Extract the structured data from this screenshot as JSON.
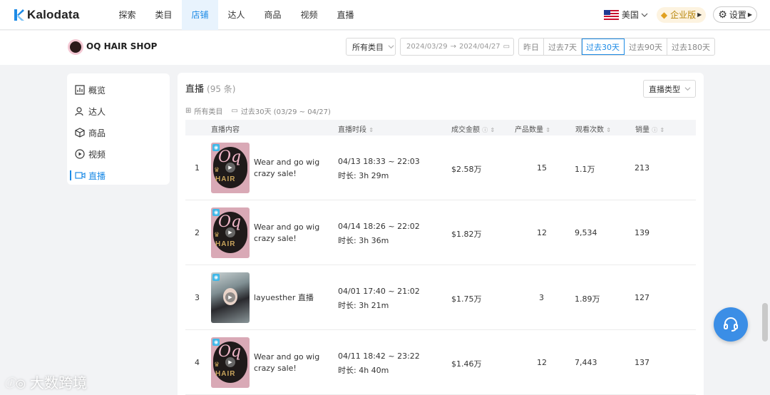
{
  "brand": {
    "name": "Kalodata",
    "color": "#1d8be6"
  },
  "nav": {
    "items": [
      {
        "label": "探索",
        "active": false
      },
      {
        "label": "类目",
        "active": false
      },
      {
        "label": "店铺",
        "active": true
      },
      {
        "label": "达人",
        "active": false
      },
      {
        "label": "商品",
        "active": false
      },
      {
        "label": "视频",
        "active": false
      },
      {
        "label": "直播",
        "active": false
      }
    ],
    "region": "美国",
    "enterprise": "企业版",
    "settings": "设置"
  },
  "shop": {
    "name": "OQ HAIR SHOP",
    "category_select": "所有类目",
    "date_start": "2024/03/29",
    "date_end": "2024/04/27",
    "periods": [
      {
        "label": "昨日",
        "active": false
      },
      {
        "label": "过去7天",
        "active": false
      },
      {
        "label": "过去30天",
        "active": true
      },
      {
        "label": "过去90天",
        "active": false
      },
      {
        "label": "过去180天",
        "active": false
      }
    ]
  },
  "sidebar": {
    "items": [
      {
        "label": "概览",
        "icon": "overview-icon",
        "active": false
      },
      {
        "label": "达人",
        "icon": "creator-icon",
        "active": false
      },
      {
        "label": "商品",
        "icon": "product-box-icon",
        "active": false
      },
      {
        "label": "视频",
        "icon": "video-play-icon",
        "active": false
      },
      {
        "label": "直播",
        "icon": "live-camera-icon",
        "active": true
      }
    ]
  },
  "panel": {
    "title": "直播",
    "count": "(95 条)",
    "type_select": "直播类型",
    "filter_category": "所有类目",
    "filter_period": "过去30天 (03/29 ~ 04/27)"
  },
  "table": {
    "headers": {
      "content": "直播内容",
      "time": "直播时段",
      "revenue": "成交金额",
      "products": "产品数量",
      "views": "观看次数",
      "sales": "销量"
    },
    "rows": [
      {
        "rank": "1",
        "thumb": "logo",
        "title": "Wear and go wig crazy sale!",
        "time": "04/13 18:33 ~ 22:03",
        "duration": "时长: 3h 29m",
        "revenue": "$2.58万",
        "products": "15",
        "views": "1.1万",
        "sales": "213"
      },
      {
        "rank": "2",
        "thumb": "logo",
        "title": "Wear and go wig crazy sale!",
        "time": "04/14 18:26 ~ 22:02",
        "duration": "时长: 3h 36m",
        "revenue": "$1.82万",
        "products": "12",
        "views": "9,534",
        "sales": "139"
      },
      {
        "rank": "3",
        "thumb": "photo",
        "title": "layuesther 直播",
        "time": "04/01 17:40 ~ 21:02",
        "duration": "时长: 3h 21m",
        "revenue": "$1.75万",
        "products": "3",
        "views": "1.89万",
        "sales": "127"
      },
      {
        "rank": "4",
        "thumb": "logo",
        "title": "Wear and go wig crazy sale!",
        "time": "04/11 18:42 ~ 23:22",
        "duration": "时长: 4h 40m",
        "revenue": "$1.46万",
        "products": "12",
        "views": "7,443",
        "sales": "137"
      }
    ]
  },
  "watermark": "大数跨境"
}
